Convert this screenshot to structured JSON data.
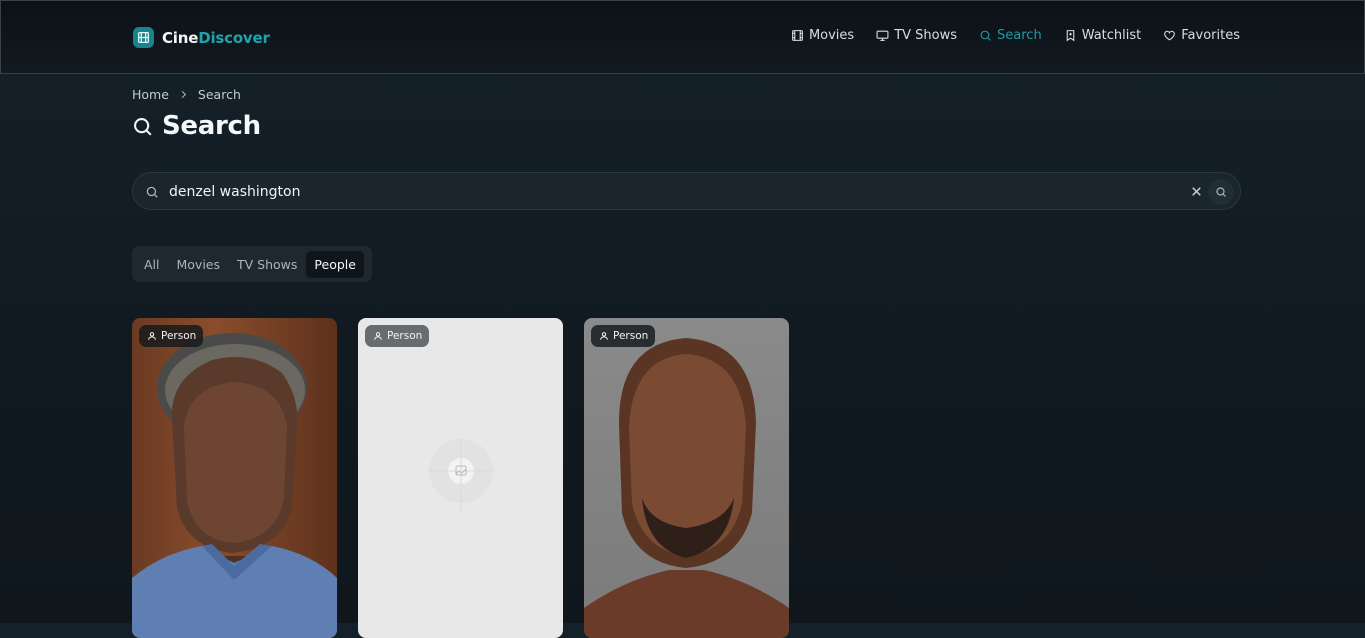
{
  "app": {
    "brand_part1": "Cine",
    "brand_part2": "Discover",
    "accent": "#1f9aa6"
  },
  "nav": {
    "items": [
      {
        "label": "Movies",
        "icon": "film-icon"
      },
      {
        "label": "TV Shows",
        "icon": "tv-icon"
      },
      {
        "label": "Search",
        "icon": "search-icon",
        "active": true
      },
      {
        "label": "Watchlist",
        "icon": "bookmark-icon"
      },
      {
        "label": "Favorites",
        "icon": "heart-icon"
      }
    ]
  },
  "breadcrumb": {
    "home": "Home",
    "current": "Search"
  },
  "page": {
    "title": "Search"
  },
  "search": {
    "value": "denzel washington",
    "placeholder": ""
  },
  "tabs": [
    {
      "label": "All"
    },
    {
      "label": "Movies"
    },
    {
      "label": "TV Shows"
    },
    {
      "label": "People",
      "active": true
    }
  ],
  "results": [
    {
      "badge": "Person",
      "image": "photo"
    },
    {
      "badge": "Person",
      "image": "placeholder"
    },
    {
      "badge": "Person",
      "image": "photo"
    }
  ]
}
